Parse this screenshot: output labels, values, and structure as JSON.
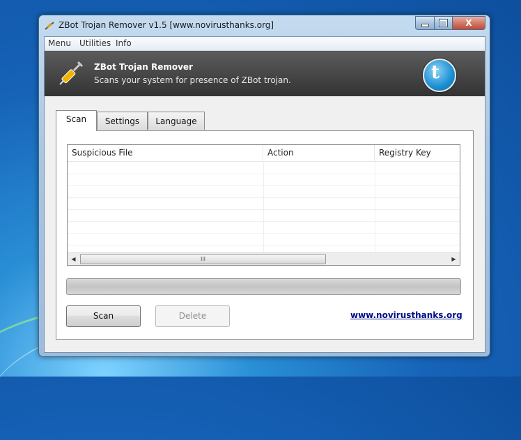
{
  "window": {
    "title": "ZBot Trojan Remover v1.5 [www.novirusthanks.org]",
    "close_glyph": "X"
  },
  "menubar": {
    "items": [
      "Menu",
      "Utilities",
      "Info"
    ]
  },
  "banner": {
    "title": "ZBot Trojan Remover",
    "subtitle": "Scans your system for presence of ZBot trojan.",
    "logo_icon": "syringe-icon",
    "social_icon": "twitter-icon",
    "social_letter": "t"
  },
  "tabs": [
    {
      "label": "Scan",
      "active": true
    },
    {
      "label": "Settings",
      "active": false
    },
    {
      "label": "Language",
      "active": false
    }
  ],
  "results_table": {
    "columns": [
      "Suspicious File",
      "Action",
      "Registry Key"
    ],
    "rows": []
  },
  "scrollbar": {
    "left_arrow": "◀",
    "right_arrow": "▶",
    "grip": "III"
  },
  "progress": {
    "value": 0
  },
  "buttons": {
    "scan_label": "Scan",
    "delete_label": "Delete"
  },
  "footer": {
    "link_text": "www.novirusthanks.org"
  },
  "colors": {
    "link": "#000f86",
    "banner_bg": "#3f3f3f",
    "twitter_blue": "#1a8fd2"
  }
}
